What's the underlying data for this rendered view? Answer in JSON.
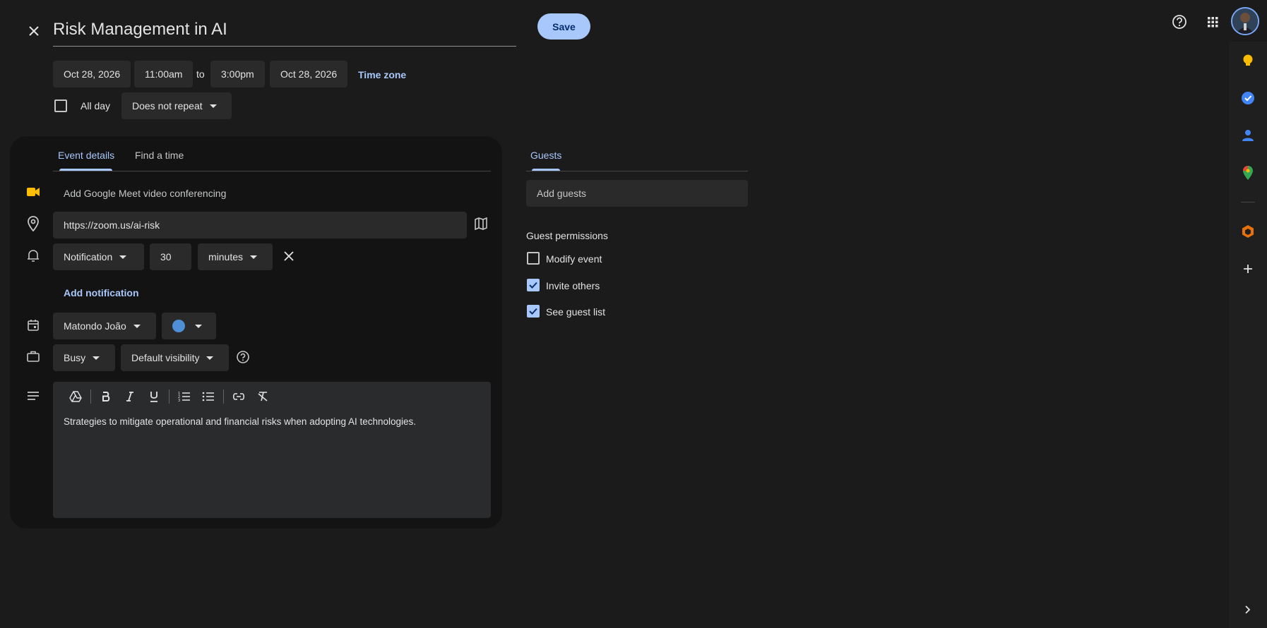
{
  "header": {
    "title": "Risk Management in AI",
    "save_label": "Save"
  },
  "datetime": {
    "start_date": "Oct 28, 2026",
    "start_time": "11:00am",
    "to_label": "to",
    "end_time": "3:00pm",
    "end_date": "Oct 28, 2026",
    "timezone_label": "Time zone",
    "all_day_label": "All day",
    "all_day_checked": false,
    "repeat": "Does not repeat"
  },
  "tabs": {
    "event_details": "Event details",
    "find_time": "Find a time",
    "guests": "Guests"
  },
  "details": {
    "meet_label": "Add Google Meet video conferencing",
    "location": "https://zoom.us/ai-risk",
    "notification_type": "Notification",
    "notification_value": "30",
    "notification_unit": "minutes",
    "add_notification": "Add notification",
    "calendar_owner": "Matondo João",
    "calendar_color": "#4f8fd8",
    "availability": "Busy",
    "visibility": "Default visibility",
    "description": "Strategies to mitigate operational and financial risks when adopting AI technologies."
  },
  "guests": {
    "add_placeholder": "Add guests",
    "permissions_title": "Guest permissions",
    "permissions": [
      {
        "label": "Modify event",
        "checked": false
      },
      {
        "label": "Invite others",
        "checked": true
      },
      {
        "label": "See guest list",
        "checked": true
      }
    ]
  },
  "rail_icons": [
    "keep-icon",
    "tasks-icon",
    "contacts-icon",
    "maps-icon",
    "addon-icon",
    "add-icon",
    "expand-icon"
  ],
  "colors": {
    "accent": "#a8c7fa",
    "background": "#1b1b1b",
    "panel": "#131313"
  }
}
